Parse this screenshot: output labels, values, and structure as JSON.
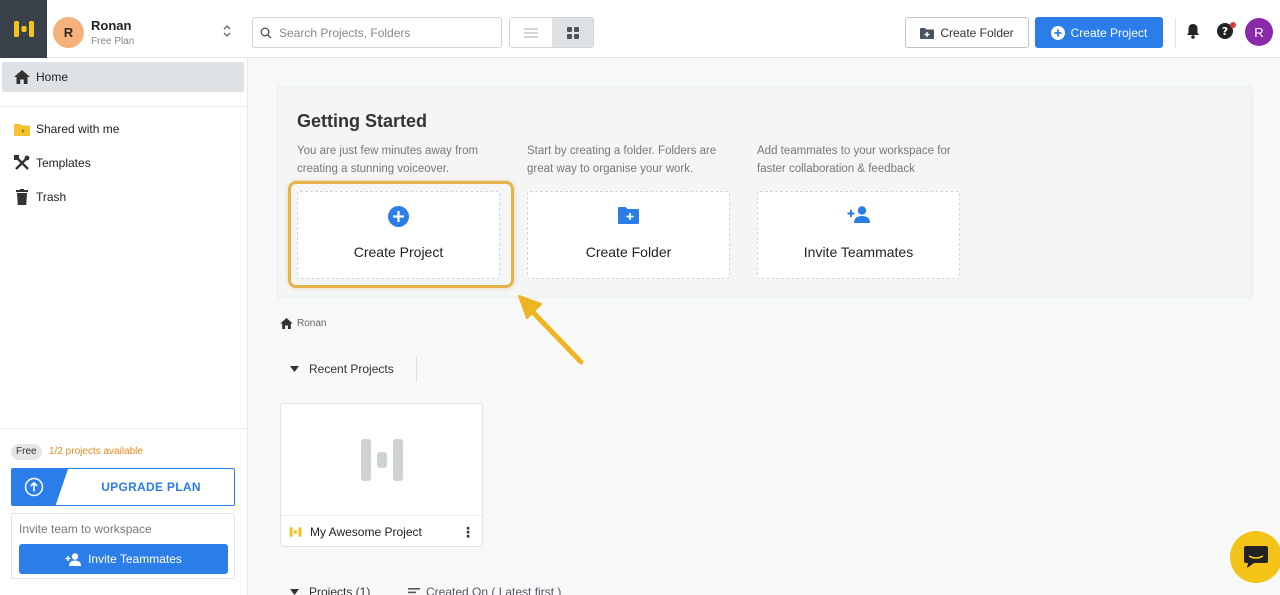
{
  "user": {
    "initial": "R",
    "name": "Ronan",
    "plan": "Free Plan"
  },
  "search": {
    "placeholder": "Search Projects, Folders"
  },
  "toolbar": {
    "create_folder_label": "Create Folder",
    "create_project_label": "Create Project",
    "avatar_initial": "R"
  },
  "sidebar": {
    "items": [
      {
        "label": "Home",
        "icon": "home-icon",
        "active": true
      },
      {
        "label": "Shared with me",
        "icon": "shared-folder-icon"
      },
      {
        "label": "Templates",
        "icon": "templates-icon"
      },
      {
        "label": "Trash",
        "icon": "trash-icon"
      }
    ],
    "plan_badge": "Free",
    "projects_available": "1/2 projects available",
    "upgrade_label": "UPGRADE PLAN",
    "invite_prompt": "Invite team to workspace",
    "invite_button": "Invite Teammates"
  },
  "getting_started": {
    "title": "Getting Started",
    "columns": [
      {
        "description": "You are just few minutes away from creating a stunning voiceover.",
        "card_label": "Create Project",
        "icon": "plus-circle-icon"
      },
      {
        "description": "Start by creating a folder. Folders are great way to organise your work.",
        "card_label": "Create Folder",
        "icon": "folder-plus-icon"
      },
      {
        "description": "Add teammates to your workspace for faster collaboration & feedback",
        "card_label": "Invite Teammates",
        "icon": "add-user-icon"
      }
    ]
  },
  "breadcrumb": {
    "label": "Ronan"
  },
  "recent": {
    "heading": "Recent Projects",
    "projects": [
      {
        "name": "My Awesome Project"
      }
    ]
  },
  "projects": {
    "heading": "Projects (1)",
    "sort_label": "Created On ( Latest first )"
  },
  "colors": {
    "accent": "#2b7de9",
    "sidebar_logo_bg": "#3a4049",
    "highlight": "#e6b24a",
    "brand_yellow": "#f3c318",
    "avatar_purple": "#8a2aa8"
  }
}
